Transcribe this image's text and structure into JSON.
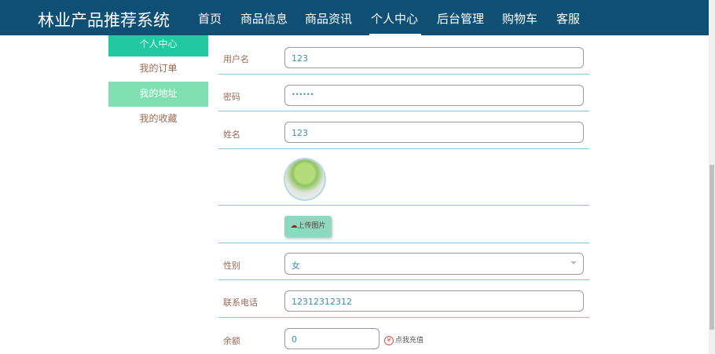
{
  "header": {
    "title": "林业产品推荐系统",
    "nav": [
      "首页",
      "商品信息",
      "商品资讯",
      "个人中心",
      "后台管理",
      "购物车",
      "客服"
    ],
    "active": "个人中心"
  },
  "sidebar": {
    "items": [
      "个人中心",
      "我的订单",
      "我的地址",
      "我的收藏"
    ]
  },
  "form": {
    "username": {
      "label": "用户名",
      "value": "123"
    },
    "password": {
      "label": "密码",
      "value": "••••••"
    },
    "name": {
      "label": "姓名",
      "value": "123"
    },
    "upload_label": "上传图片",
    "gender": {
      "label": "性别",
      "value": "女"
    },
    "phone": {
      "label": "联系电话",
      "value": "12312312312"
    },
    "balance": {
      "label": "余额",
      "value": "0",
      "recharge": "点我充值",
      "yen": "¥"
    }
  },
  "colors": {
    "header": "#0f4f74",
    "sidebar_head": "#20c9a0",
    "sidebar_hover": "#7fdfb0"
  }
}
